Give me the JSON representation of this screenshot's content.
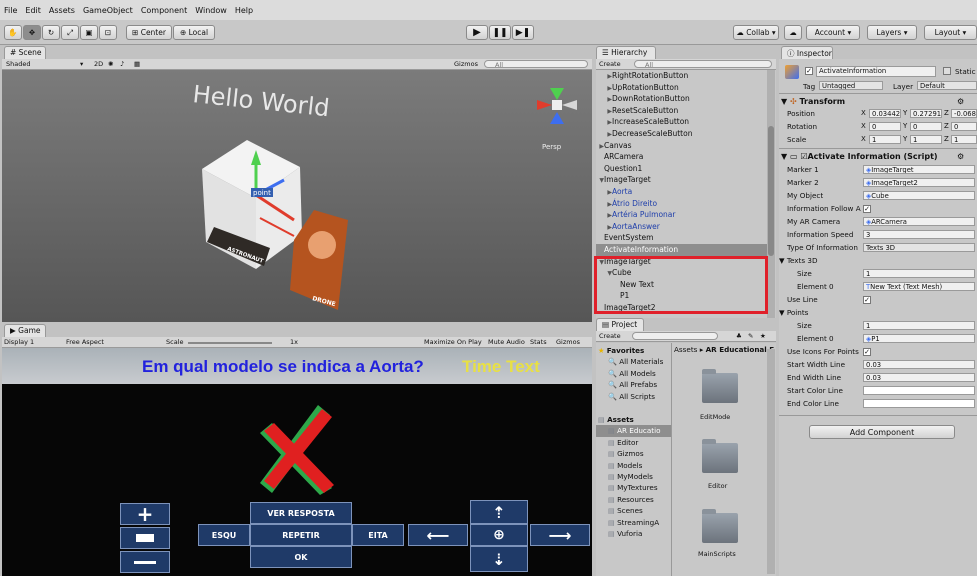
{
  "menu": [
    "File",
    "Edit",
    "Assets",
    "GameObject",
    "Component",
    "Window",
    "Help"
  ],
  "toolbar": {
    "center": "Center",
    "local": "Local",
    "collab": "Collab",
    "account": "Account",
    "layers": "Layers",
    "layout": "Layout"
  },
  "scene": {
    "tab": "Scene",
    "shading": "Shaded",
    "mode_2d": "2D",
    "gizmos": "Gizmos",
    "search": "All",
    "hello": "Hello World",
    "persp": "Persp",
    "point": "point",
    "card1": "ASTRONAUT",
    "card2": "DRONE"
  },
  "game": {
    "tab": "Game",
    "display": "Display 1",
    "aspect": "Free Aspect",
    "scale_label": "Scale",
    "scale_value": "1x",
    "max_on_play": "Maximize On Play",
    "mute": "Mute Audio",
    "stats": "Stats",
    "gizmos": "Gizmos",
    "question": "Em qual modelo se indica a Aorta?",
    "time_text": "Time Text",
    "btn_ver": "VER RESPOSTA",
    "btn_esq": "ESQU",
    "btn_repetir": "REPETIR",
    "btn_eita": "EITA",
    "btn_ok": "OK"
  },
  "hierarchy": {
    "tab": "Hierarchy",
    "create": "Create",
    "search": "All",
    "items": [
      {
        "label": "RightRotationButton",
        "indent": 2,
        "arrow": "▶",
        "selected": false,
        "blue": false
      },
      {
        "label": "UpRotationButton",
        "indent": 2,
        "arrow": "▶",
        "selected": false,
        "blue": false
      },
      {
        "label": "DownRotationButton",
        "indent": 2,
        "arrow": "▶",
        "selected": false,
        "blue": false
      },
      {
        "label": "ResetScaleButton",
        "indent": 2,
        "arrow": "▶",
        "selected": false,
        "blue": false
      },
      {
        "label": "IncreaseScaleButton",
        "indent": 2,
        "arrow": "▶",
        "selected": false,
        "blue": false
      },
      {
        "label": "DecreaseScaleButton",
        "indent": 2,
        "arrow": "▶",
        "selected": false,
        "blue": false
      },
      {
        "label": "Canvas",
        "indent": 1,
        "arrow": "▶",
        "selected": false,
        "blue": false
      },
      {
        "label": "ARCamera",
        "indent": 1,
        "arrow": "",
        "selected": false,
        "blue": false
      },
      {
        "label": "Question1",
        "indent": 1,
        "arrow": "",
        "selected": false,
        "blue": false
      },
      {
        "label": "ImageTarget",
        "indent": 1,
        "arrow": "▼",
        "selected": false,
        "blue": false
      },
      {
        "label": "Aorta",
        "indent": 2,
        "arrow": "▶",
        "selected": false,
        "blue": true
      },
      {
        "label": "Átrio Direito",
        "indent": 2,
        "arrow": "▶",
        "selected": false,
        "blue": true
      },
      {
        "label": "Artéria Pulmonar",
        "indent": 2,
        "arrow": "▶",
        "selected": false,
        "blue": true
      },
      {
        "label": "AortaAnswer",
        "indent": 2,
        "arrow": "▶",
        "selected": false,
        "blue": true
      },
      {
        "label": "EventSystem",
        "indent": 1,
        "arrow": "",
        "selected": false,
        "blue": false
      },
      {
        "label": "ActivateInformation",
        "indent": 1,
        "arrow": "",
        "selected": true,
        "blue": false
      },
      {
        "label": "ImageTarget",
        "indent": 1,
        "arrow": "▼",
        "selected": false,
        "blue": false
      },
      {
        "label": "Cube",
        "indent": 2,
        "arrow": "▼",
        "selected": false,
        "blue": false
      },
      {
        "label": "New Text",
        "indent": 3,
        "arrow": "",
        "selected": false,
        "blue": false
      },
      {
        "label": "P1",
        "indent": 3,
        "arrow": "",
        "selected": false,
        "blue": false
      },
      {
        "label": "ImageTarget2",
        "indent": 1,
        "arrow": "",
        "selected": false,
        "blue": false
      }
    ]
  },
  "project": {
    "tab": "Project",
    "create": "Create",
    "breadcrumb_root": "Assets",
    "breadcrumb_current": "AR Educational F",
    "favorites": "Favorites",
    "fav_items": [
      "All Materials",
      "All Models",
      "All Prefabs",
      "All Scripts"
    ],
    "assets": "Assets",
    "asset_items": [
      "AR Educatio",
      "Editor",
      "Gizmos",
      "Models",
      "MyModels",
      "MyTextures",
      "Resources",
      "Scenes",
      "StreamingA",
      "Vuforia"
    ],
    "folders": [
      "EditMode",
      "Editor",
      "MainScripts"
    ]
  },
  "inspector": {
    "tab": "Inspector",
    "object_name": "ActivateInformation",
    "static": "Static",
    "tag_label": "Tag",
    "tag_value": "Untagged",
    "layer_label": "Layer",
    "layer_value": "Default",
    "transform": "Transform",
    "position_label": "Position",
    "pos_x": "0.03442",
    "pos_y": "0.27291",
    "pos_z": "-0.068",
    "rotation_label": "Rotation",
    "rot_x": "0",
    "rot_y": "0",
    "rot_z": "0",
    "scale_label": "Scale",
    "scl_x": "1",
    "scl_y": "1",
    "scl_z": "1",
    "script_title": "Activate Information (Script)",
    "marker1_label": "Marker 1",
    "marker1": "ImageTarget",
    "marker2_label": "Marker 2",
    "marker2": "ImageTarget2",
    "myobject_label": "My Object",
    "myobject": "Cube",
    "follow_label": "Information Follow A",
    "camera_label": "My AR Camera",
    "camera": "ARCamera",
    "speed_label": "Information Speed",
    "speed": "3",
    "type_label": "Type Of Information",
    "type": "Texts 3D",
    "texts3d": "Texts 3D",
    "size_label": "Size",
    "size1": "1",
    "element0_label": "Element 0",
    "element0_text": "New Text (Text Mesh)",
    "useline": "Use Line",
    "points": "Points",
    "size2": "1",
    "element0_point": "P1",
    "useicons": "Use Icons For Points",
    "startwidth_label": "Start Width Line",
    "startwidth": "0.03",
    "endwidth_label": "End Width Line",
    "endwidth": "0.03",
    "startcolor_label": "Start Color Line",
    "endcolor_label": "End Color Line",
    "add_component": "Add Component"
  }
}
